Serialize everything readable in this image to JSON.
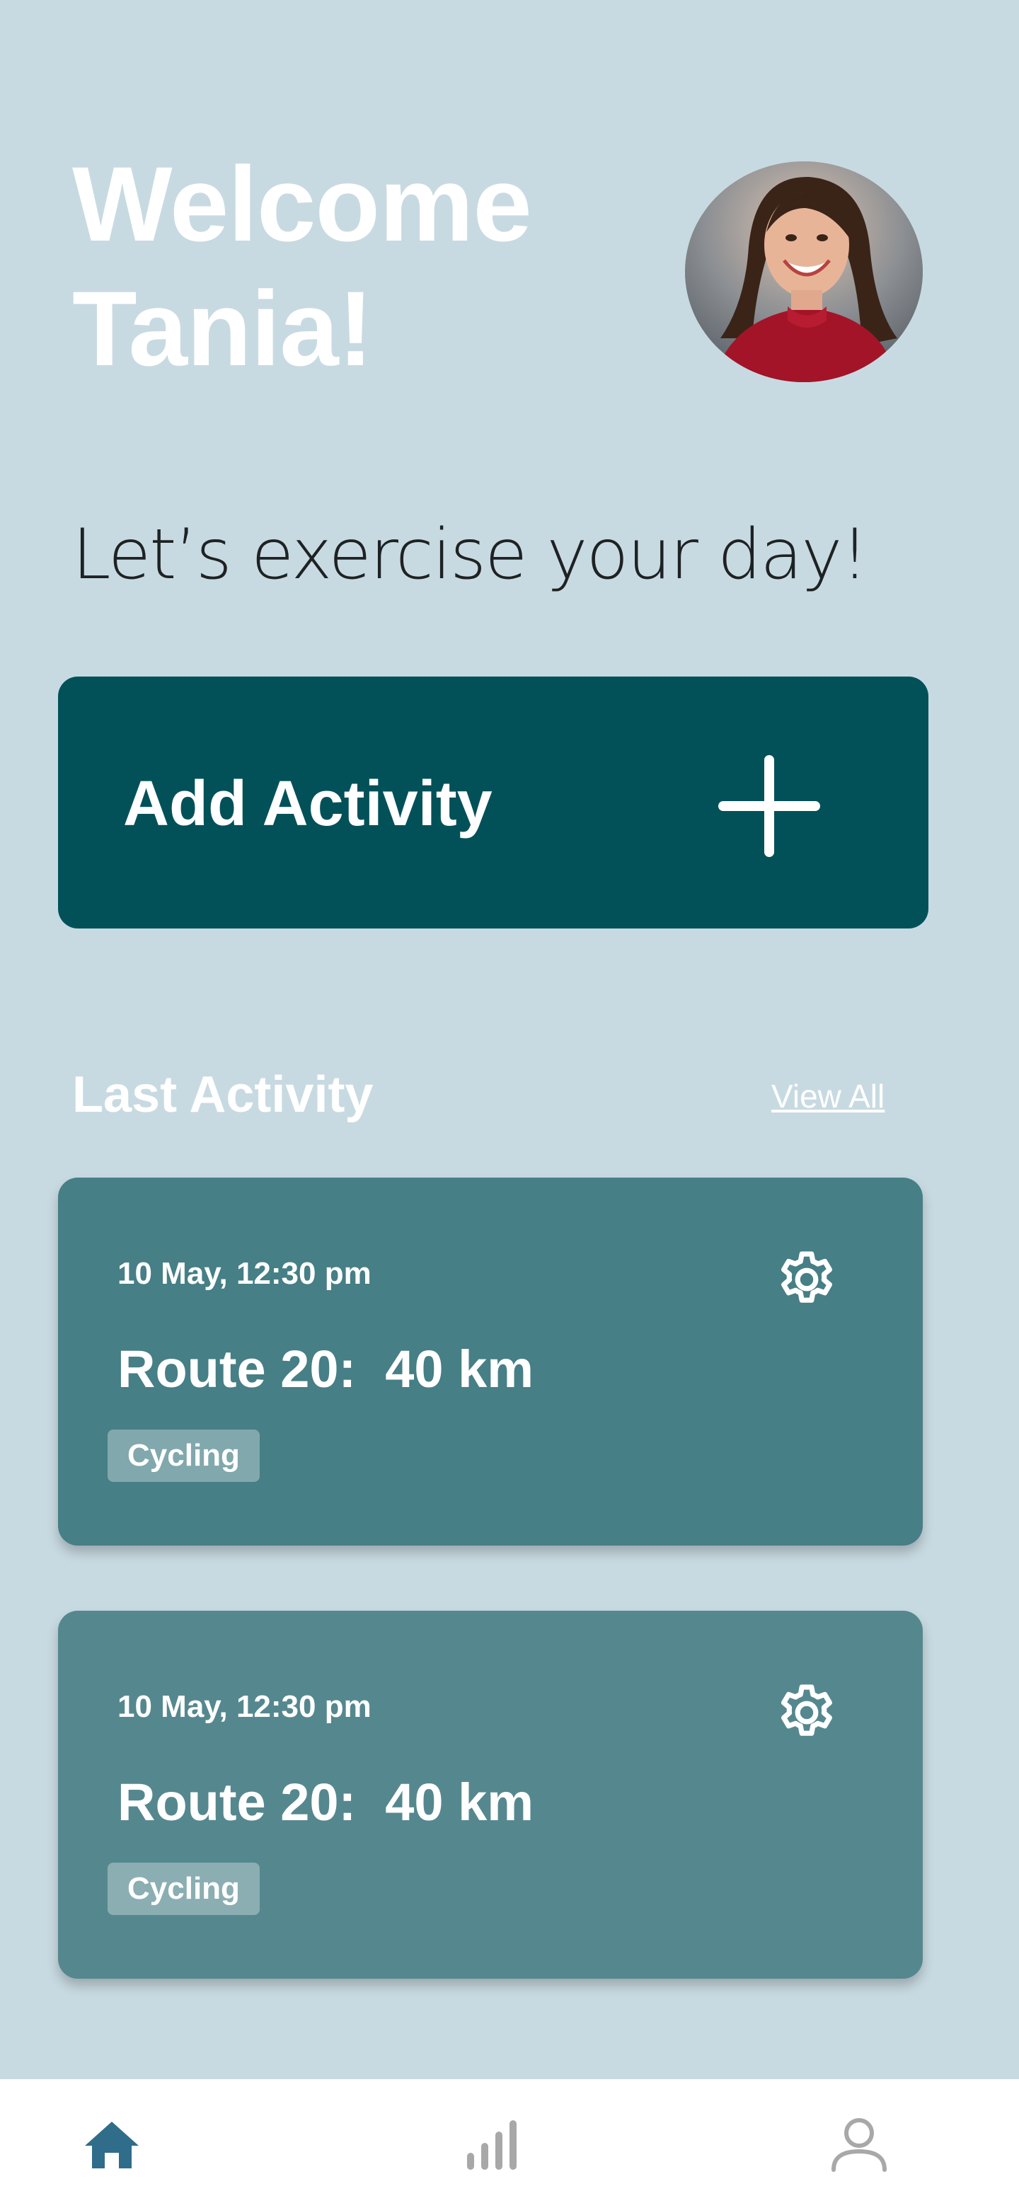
{
  "header": {
    "welcome_line1": "Welcome",
    "welcome_line2": "Tania!",
    "avatar_icon": "user-photo"
  },
  "tagline": "Let’s exercise your day!",
  "add_activity": {
    "label": "Add Activity",
    "icon": "plus-icon"
  },
  "last_activity": {
    "title": "Last Activity",
    "view_all_label": "View All",
    "items": [
      {
        "date": "10 May, 12:30 pm",
        "route": "Route 20:  40 km",
        "tag": "Cycling",
        "icon": "gear-icon"
      },
      {
        "date": "10 May, 12:30 pm",
        "route": "Route 20:  40 km",
        "tag": "Cycling",
        "icon": "gear-icon"
      }
    ]
  },
  "bottom_nav": {
    "items": [
      {
        "icon": "home-icon",
        "active": true
      },
      {
        "icon": "stats-icon",
        "active": false
      },
      {
        "icon": "profile-icon",
        "active": false
      }
    ]
  },
  "colors": {
    "background": "#c8dae1",
    "primary": "#025159",
    "card_1": "#467f85",
    "card_2": "#55888e",
    "nav_active": "#2f6d8a",
    "nav_inactive": "#a8a8a8"
  }
}
